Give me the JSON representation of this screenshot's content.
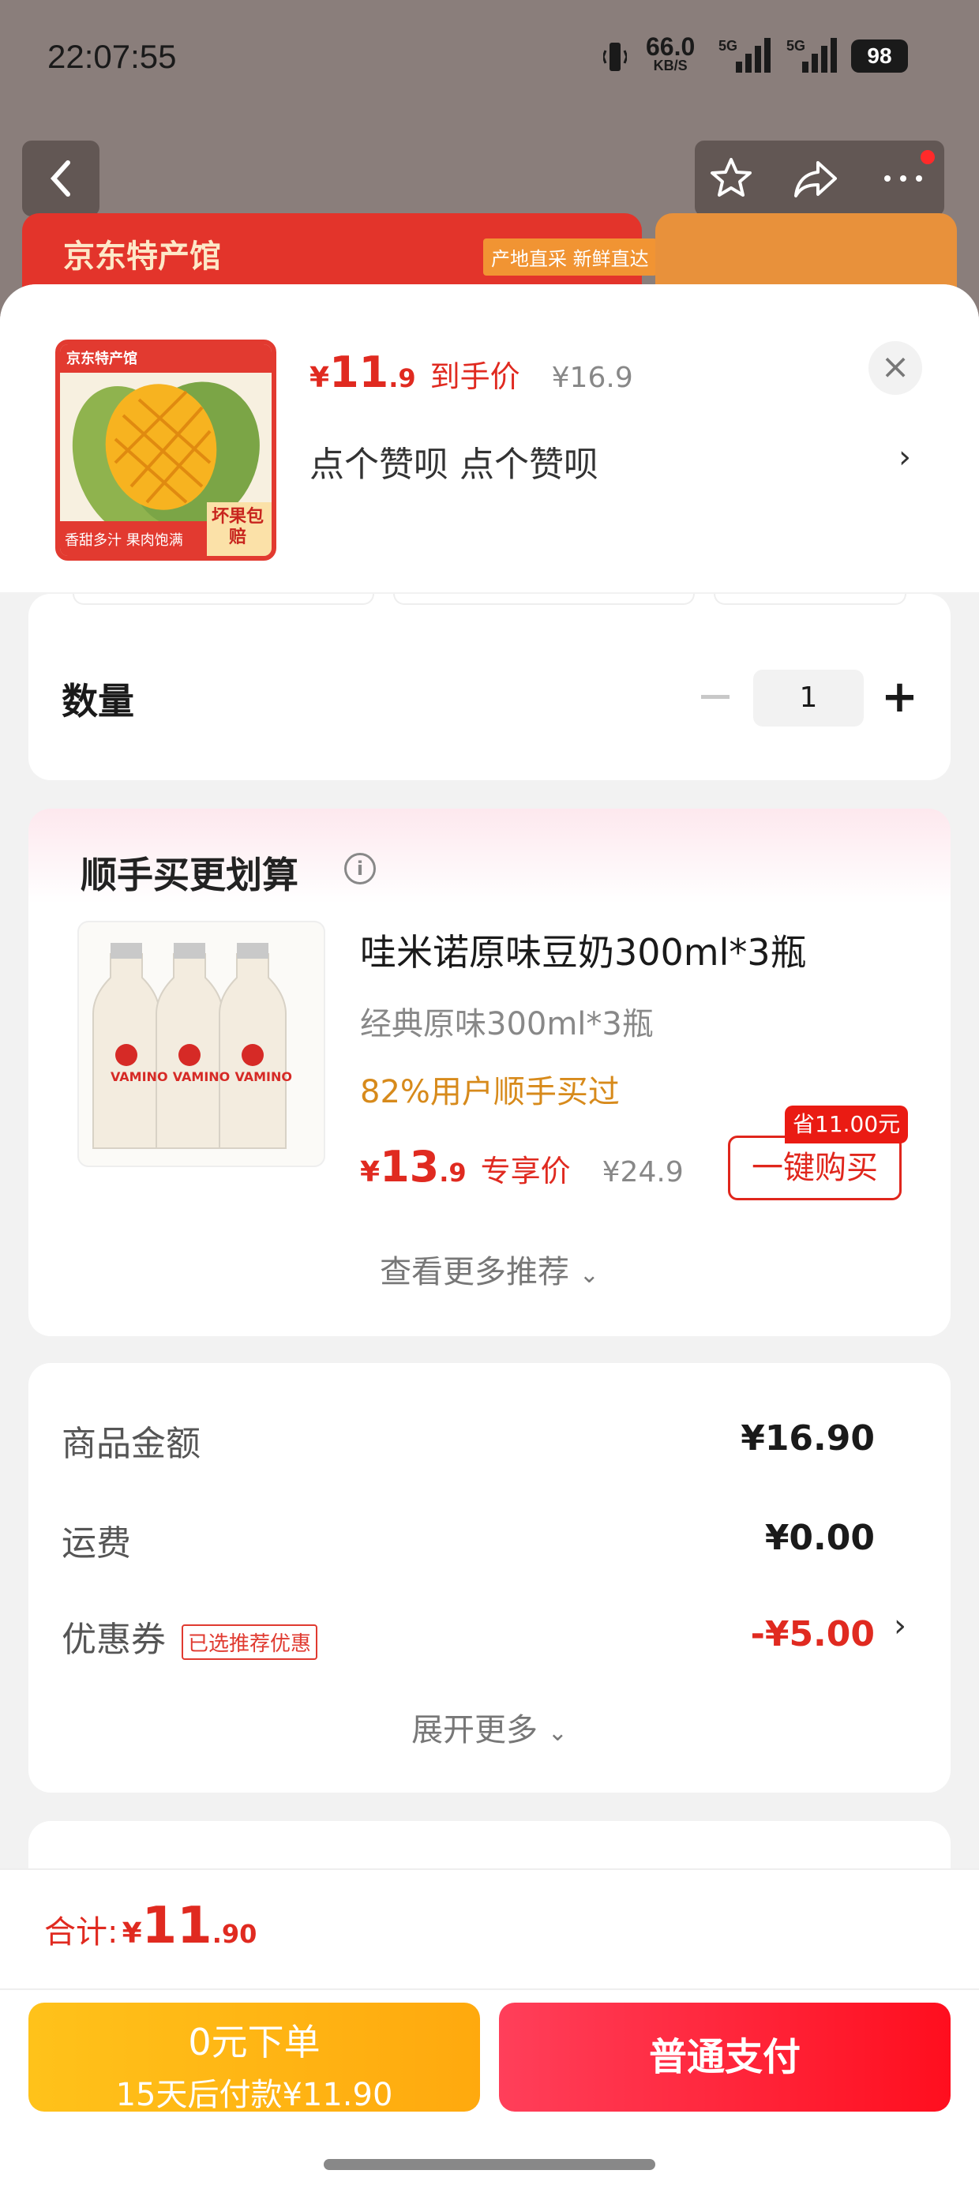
{
  "status_bar": {
    "time": "22:07:55",
    "net_speed": "66.0",
    "net_unit": "KB/S",
    "net_type_1": "5G",
    "net_type_2": "5G",
    "battery": "98"
  },
  "background_page": {
    "banner_title": "京东特产馆",
    "banner_tag": "产地直采 新鲜直达"
  },
  "product": {
    "price_yen": "¥",
    "price_int": "11",
    "price_dec": ".9",
    "price_label": "到手价",
    "original_price": "¥16.9",
    "description": "点个赞呗  点个赞呗",
    "thumb_text_top": "京东特产馆",
    "thumb_text_bottom": "香甜多汁 果肉饱满",
    "thumb_badge": "坏果包赔"
  },
  "quantity": {
    "label": "数量",
    "value": "1"
  },
  "recommend": {
    "title": "顺手买更划算",
    "item": {
      "title": "哇米诺原味豆奶300ml*3瓶",
      "spec": "经典原味300ml*3瓶",
      "bought_by": "82%用户顺手买过",
      "price_yen": "¥",
      "price_int": "13",
      "price_dec": ".9",
      "price_label": "专享价",
      "original_price": "¥24.9",
      "save_tag": "省11.00元",
      "buy_button": "一键购买",
      "brand": "VAMINO"
    },
    "more": "查看更多推荐"
  },
  "summary": {
    "goods_label": "商品金额",
    "goods_value": "¥16.90",
    "shipping_label": "运费",
    "shipping_value": "¥0.00",
    "coupon_label": "优惠券",
    "coupon_tag": "已选推荐优惠",
    "coupon_value": "-¥5.00",
    "expand": "展开更多"
  },
  "footer": {
    "total_label": "合计:",
    "total_yen": "¥",
    "total_int": "11",
    "total_dec": ".90",
    "pay_later_line1": "0元下单",
    "pay_later_line2": "15天后付款¥11.90",
    "pay_now": "普通支付"
  },
  "colors": {
    "accent_red": "#e02a20",
    "bought_orange": "#d78a1b",
    "pay_later_yellow": "#ffb414",
    "pay_now_red": "#ff1e34"
  }
}
